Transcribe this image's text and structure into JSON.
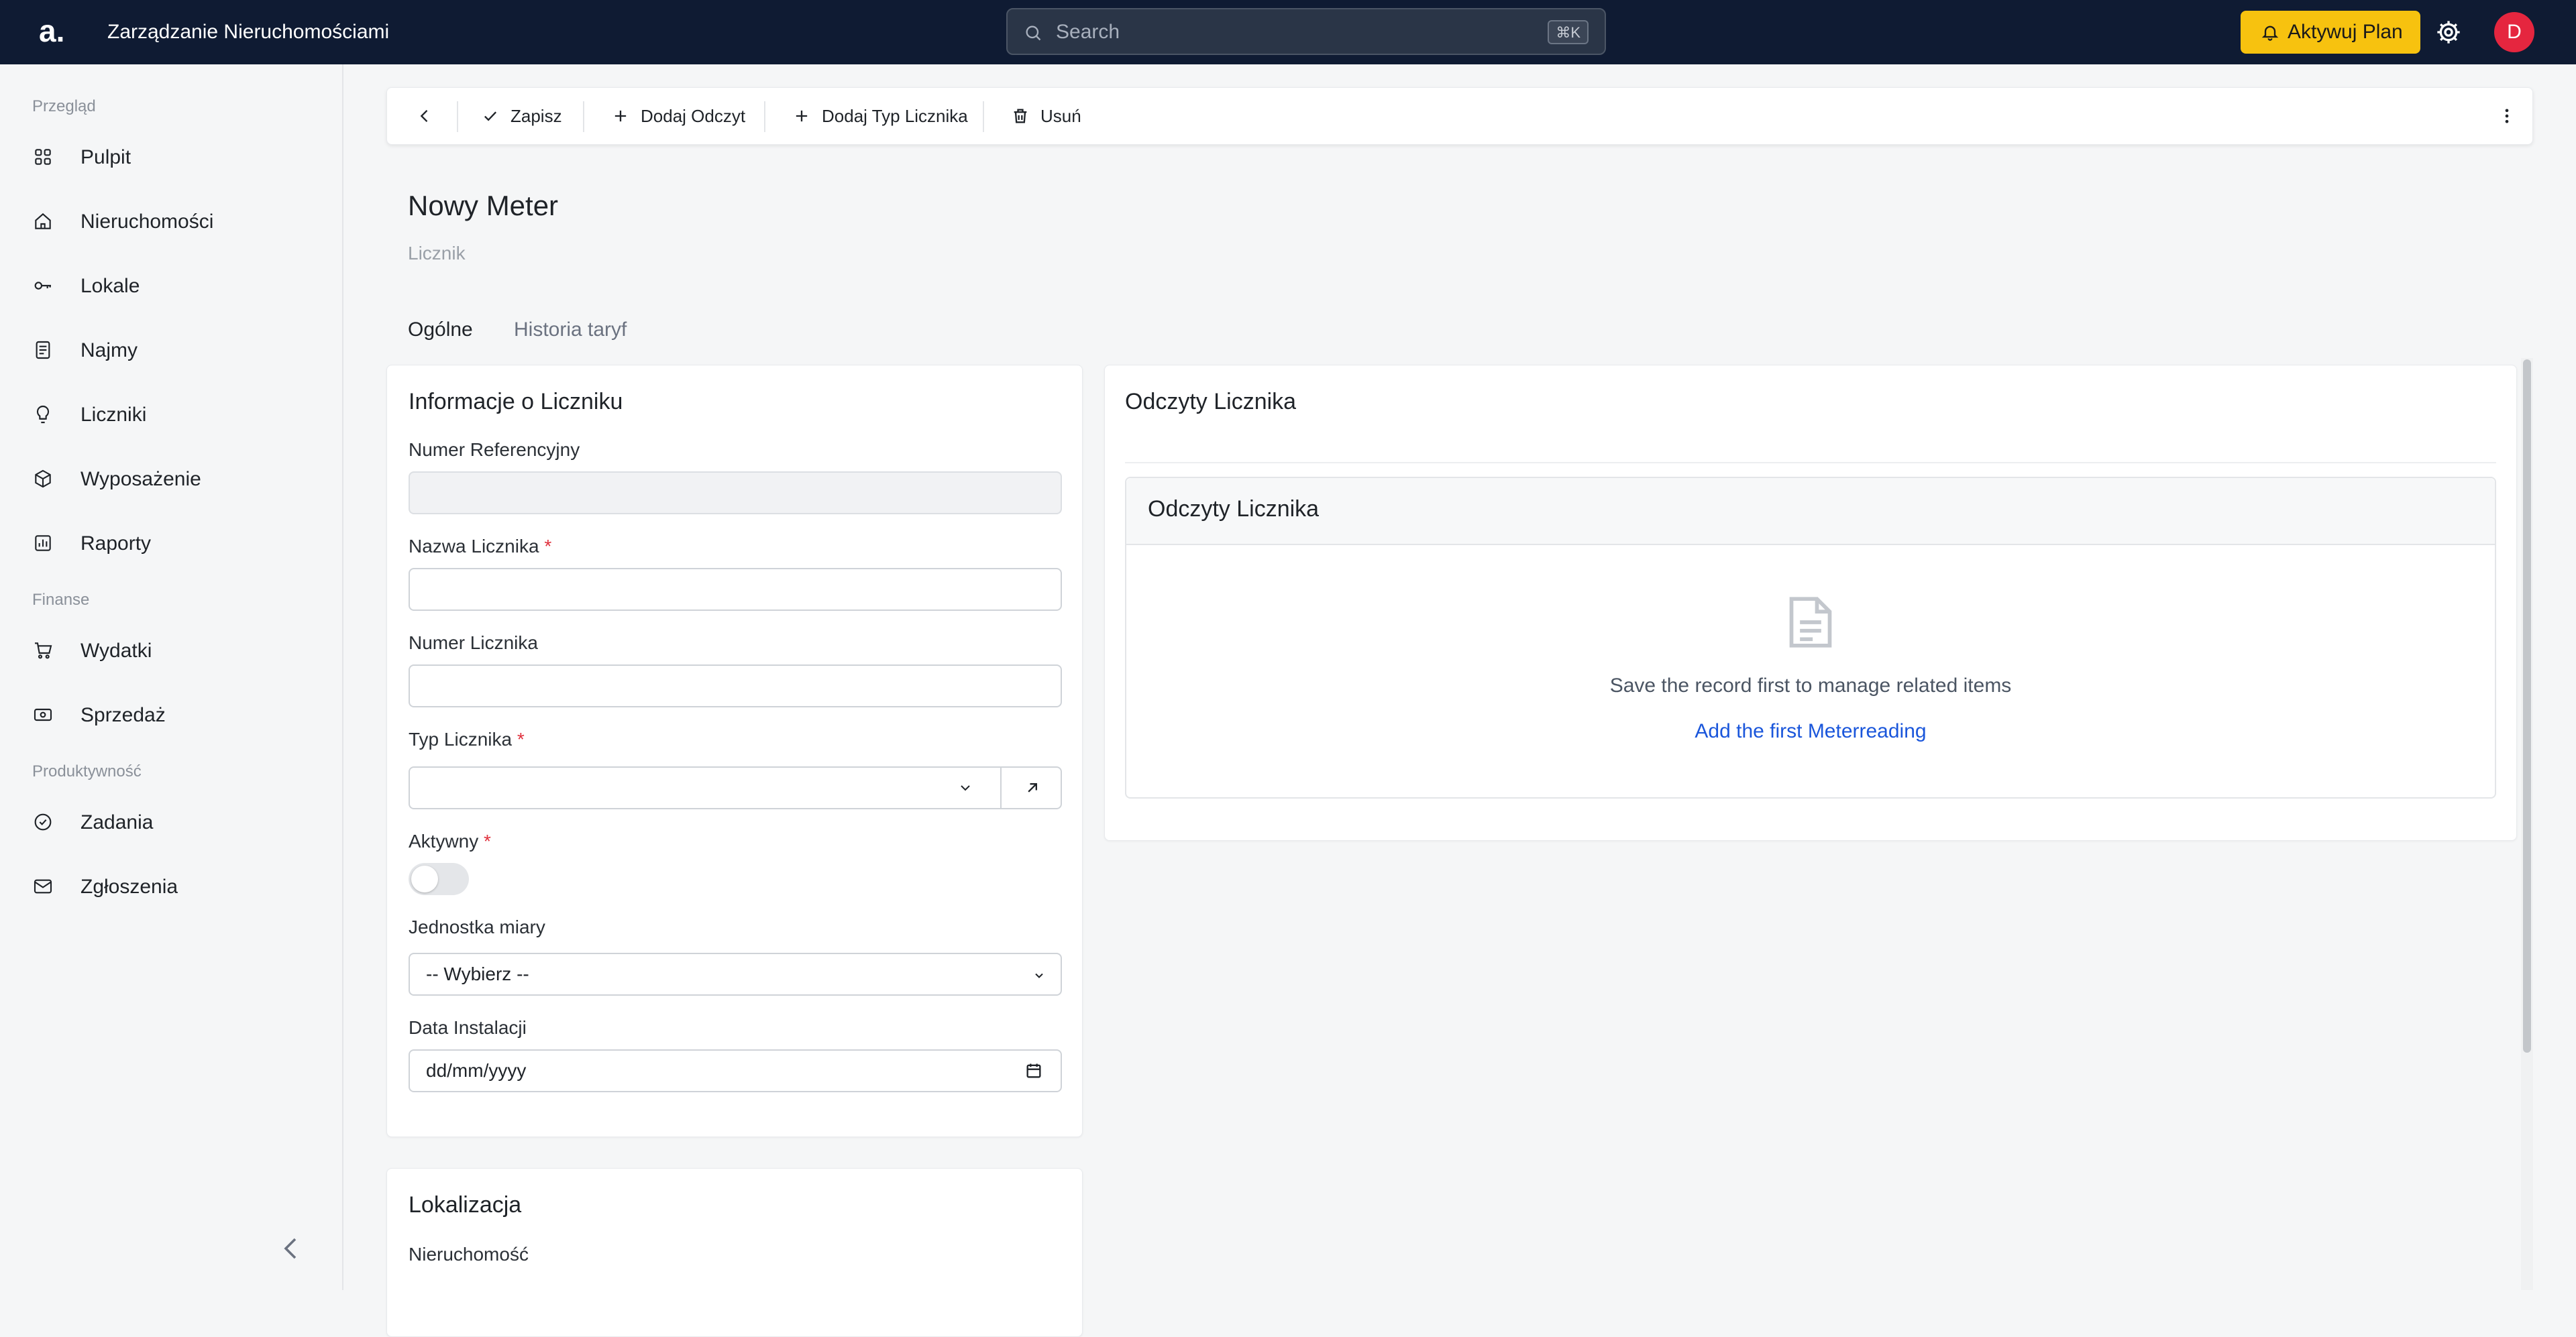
{
  "topbar": {
    "logo": "a.",
    "app_title": "Zarządzanie Nieruchomościami",
    "search_placeholder": "Search",
    "search_shortcut": "⌘K",
    "plan_button": "Aktywuj Plan",
    "avatar_initial": "D",
    "colors": {
      "background": "#0f1b33",
      "plan_button": "#f7c20f",
      "avatar": "#e5263f"
    }
  },
  "sidebar": {
    "sections": [
      {
        "title": "Przegląd",
        "items": [
          {
            "label": "Pulpit",
            "icon": "grid-icon"
          },
          {
            "label": "Nieruchomości",
            "icon": "home-icon"
          },
          {
            "label": "Lokale",
            "icon": "key-icon"
          },
          {
            "label": "Najmy",
            "icon": "document-icon"
          },
          {
            "label": "Liczniki",
            "icon": "bulb-icon"
          },
          {
            "label": "Wyposażenie",
            "icon": "box-icon"
          },
          {
            "label": "Raporty",
            "icon": "chart-icon"
          }
        ]
      },
      {
        "title": "Finanse",
        "items": [
          {
            "label": "Wydatki",
            "icon": "cart-icon"
          },
          {
            "label": "Sprzedaż",
            "icon": "money-icon"
          }
        ]
      },
      {
        "title": "Produktywność",
        "items": [
          {
            "label": "Zadania",
            "icon": "check-circle-icon"
          },
          {
            "label": "Zgłoszenia",
            "icon": "mail-icon"
          }
        ]
      }
    ]
  },
  "toolbar": {
    "save": "Zapisz",
    "add_reading": "Dodaj Odczyt",
    "add_meter_type": "Dodaj Typ Licznika",
    "delete": "Usuń"
  },
  "header": {
    "title": "Nowy Meter",
    "subtitle": "Licznik",
    "tabs": [
      "Ogólne",
      "Historia taryf"
    ],
    "active_tab": "Ogólne"
  },
  "info_card": {
    "title": "Informacje o Liczniku",
    "fields": {
      "reference_number": {
        "label": "Numer Referencyjny",
        "value": ""
      },
      "meter_name": {
        "label": "Nazwa Licznika",
        "required": "*",
        "value": ""
      },
      "meter_number": {
        "label": "Numer Licznika",
        "value": ""
      },
      "meter_type": {
        "label": "Typ Licznika",
        "required": "*",
        "value": ""
      },
      "active": {
        "label": "Aktywny",
        "required": "*",
        "value": "off"
      },
      "unit": {
        "label": "Jednostka miary",
        "value": "-- Wybierz --"
      },
      "install_date": {
        "label": "Data Instalacji",
        "value": "dd/mm/yyyy"
      }
    }
  },
  "location_card": {
    "title": "Lokalizacja",
    "property_label": "Nieruchomość"
  },
  "readings_card": {
    "title": "Odczyty Licznika",
    "inner_title": "Odczyty Licznika",
    "empty_message": "Save the record first to manage related items",
    "add_link": "Add the first Meterreading",
    "link_color": "#1a56db"
  }
}
